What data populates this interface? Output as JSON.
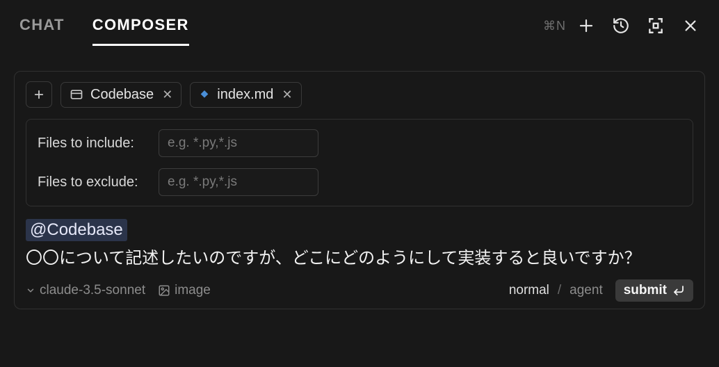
{
  "tabs": {
    "chat": "CHAT",
    "composer": "COMPOSER"
  },
  "shortcut": "⌘N",
  "chips": {
    "codebase": "Codebase",
    "file": "index.md"
  },
  "filters": {
    "include_label": "Files to include:",
    "exclude_label": "Files to exclude:",
    "placeholder": "e.g. *.py,*.js"
  },
  "mention": "@Codebase",
  "prompt": "〇〇について記述したいのですが、どこにどのようにして実装すると良いですか？",
  "footer": {
    "model": "claude-3.5-sonnet",
    "image": "image",
    "mode_normal": "normal",
    "mode_agent": "agent",
    "submit": "submit"
  }
}
